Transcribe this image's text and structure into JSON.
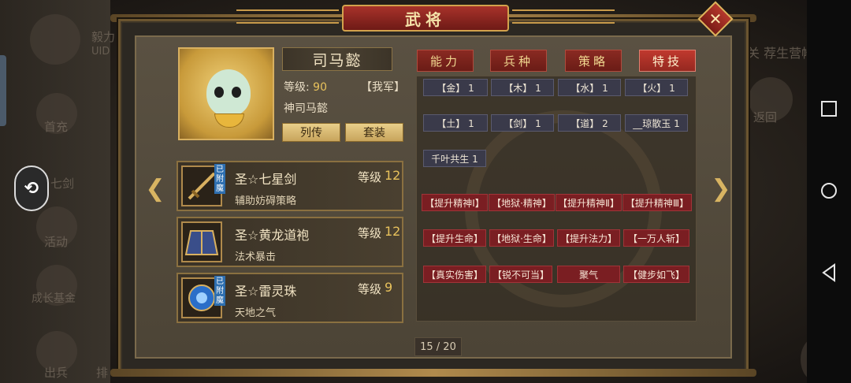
{
  "window": {
    "title": "武将"
  },
  "background": {
    "left_texts": [
      "毅力",
      "UID",
      "首充",
      "七剑",
      "活动",
      "成长基金",
      "出兵",
      "排"
    ],
    "right_texts": [
      "关 荐生营帐",
      "返回"
    ]
  },
  "general": {
    "name": "司马懿",
    "level_label": "等级:",
    "level_value": "90",
    "faction": "【我军】",
    "title": "神司马懿",
    "btn_biography": "列传",
    "btn_set": "套装"
  },
  "equipment": [
    {
      "name": "圣☆七星剑",
      "level_label": "等级",
      "level": "12",
      "desc": "辅助妨碍策略",
      "tag": "已附魔",
      "icon": "sword-icon"
    },
    {
      "name": "圣☆黄龙道袍",
      "level_label": "等级",
      "level": "12",
      "desc": "法术暴击",
      "tag": "",
      "icon": "robe-icon"
    },
    {
      "name": "圣☆雷灵珠",
      "level_label": "等级",
      "level": "9",
      "desc": "天地之气",
      "tag": "已附魔",
      "icon": "orb-icon"
    }
  ],
  "tabs": [
    {
      "label": "能力",
      "active": false
    },
    {
      "label": "兵种",
      "active": false
    },
    {
      "label": "策略",
      "active": false
    },
    {
      "label": "特技",
      "active": true
    }
  ],
  "attributes": [
    "【金】 1",
    "【木】 1",
    "【水】 1",
    "【火】 1",
    "【土】 1",
    "【剑】 1",
    "【道】 2",
    "__琼散玉 1",
    "千叶共生 1"
  ],
  "skills": [
    "【提升精神Ⅰ】",
    "【地狱·精神】",
    "【提升精神Ⅱ】",
    "【提升精神Ⅲ】",
    "【提升生命】",
    "【地狱·生命】",
    "【提升法力】",
    "【一万人斩】",
    "【真实伤害】",
    "【锐不可当】",
    "聚气",
    "【健步如飞】"
  ],
  "pager": {
    "text": "15 / 20"
  },
  "colors": {
    "accent_red": "#8a2a22",
    "gold": "#e8c25c",
    "panel": "#4c4436"
  }
}
